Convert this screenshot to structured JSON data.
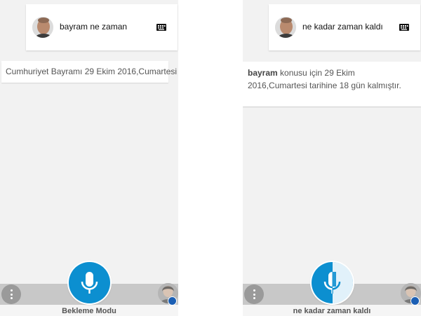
{
  "left_screen": {
    "user_query": "bayram ne zaman",
    "answer": "Cumhuriyet Bayramı 29 Ekim 2016,Cumartesi",
    "status": "Bekleme Modu"
  },
  "right_screen": {
    "user_query": "ne kadar zaman kaldı",
    "answer_bold": "bayram",
    "answer_rest": " konusu için 29 Ekim 2016,Cumartesi tarihine 18 gün kalmıştır.",
    "status": "ne kadar zaman kaldı"
  },
  "colors": {
    "mic_button": "#0c8fd0",
    "bottom_bar": "#c8c8c8",
    "background": "#f2f2f2"
  },
  "icons": {
    "keyboard": "keyboard-icon",
    "mic": "microphone-icon",
    "menu": "more-vertical-icon"
  }
}
